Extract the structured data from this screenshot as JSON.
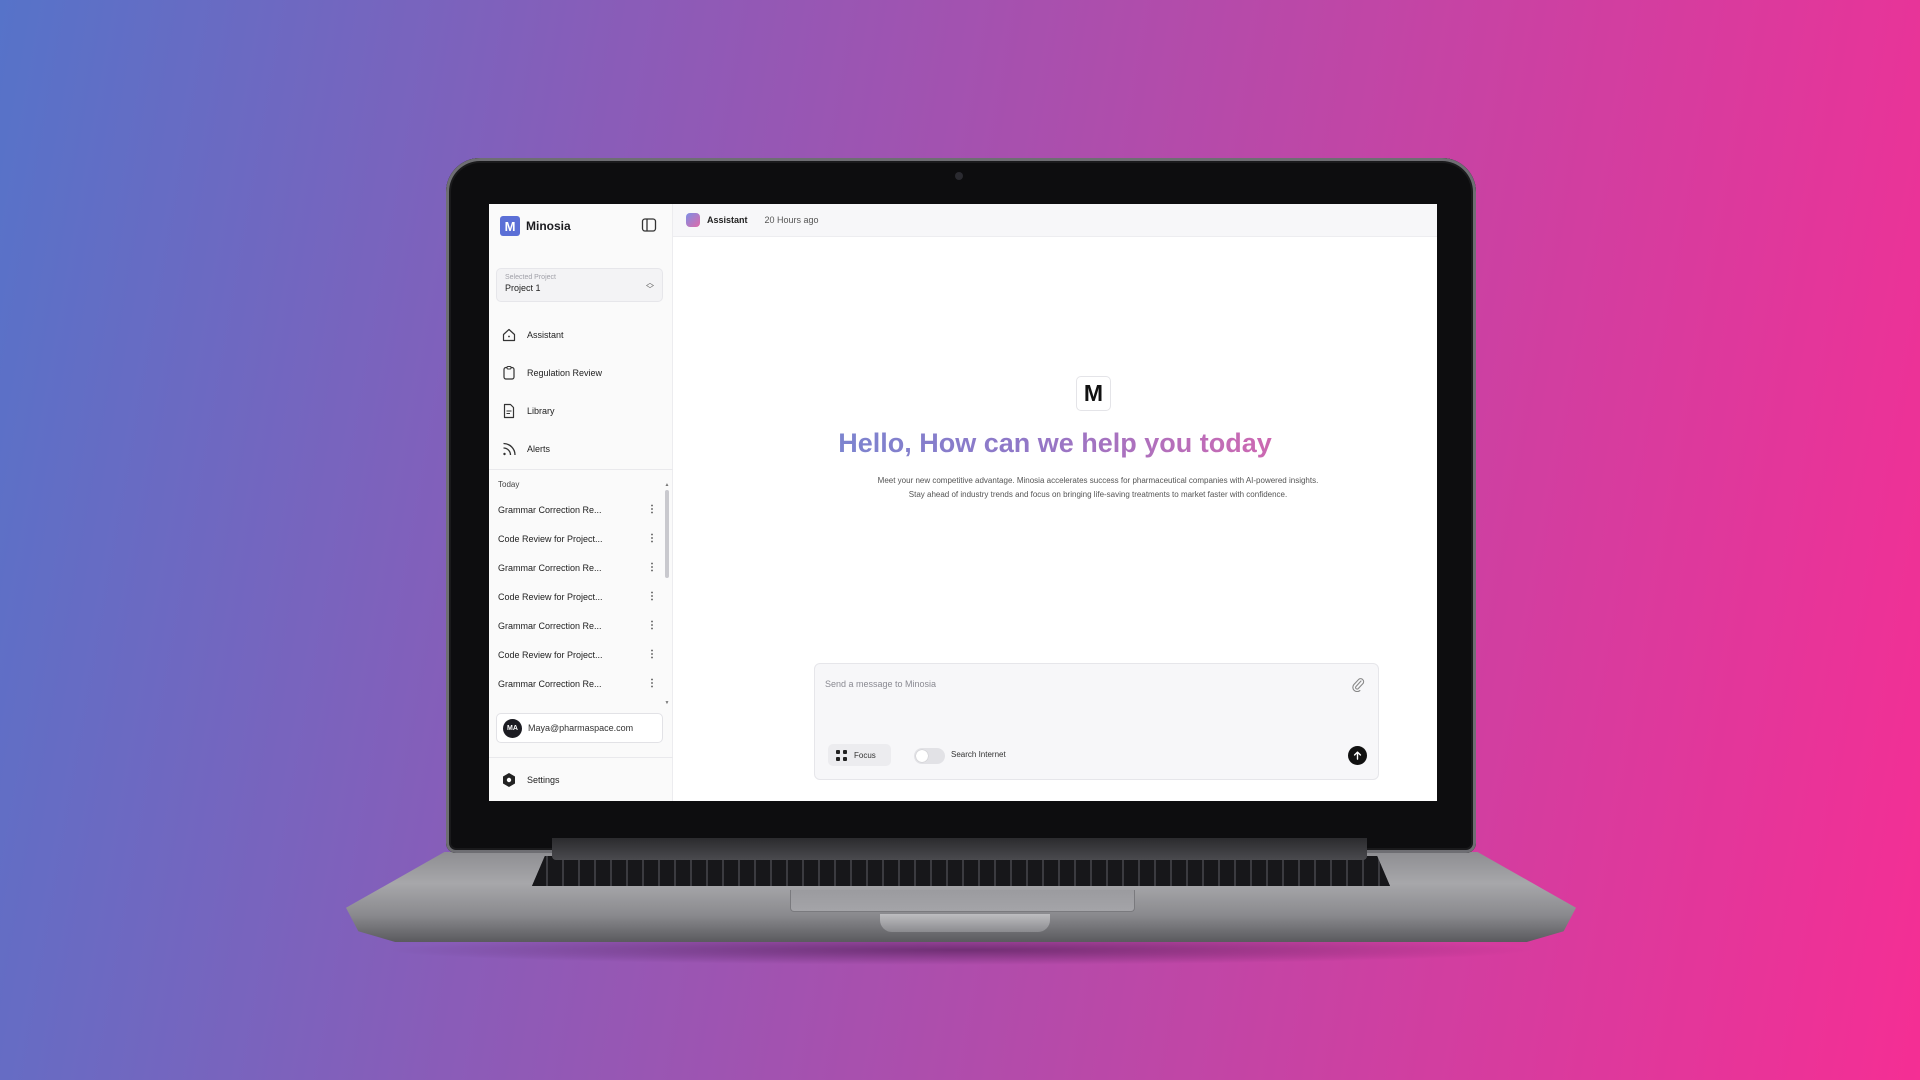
{
  "app": {
    "name": "Minosia",
    "logo_letter": "M"
  },
  "sidebar": {
    "project": {
      "caption": "Selected Project",
      "value": "Project 1"
    },
    "nav": [
      {
        "label": "Assistant",
        "icon": "home-icon"
      },
      {
        "label": "Regulation Review",
        "icon": "clipboard-icon"
      },
      {
        "label": "Library",
        "icon": "document-icon"
      },
      {
        "label": "Alerts",
        "icon": "rss-icon"
      }
    ],
    "history_heading": "Today",
    "history": [
      "Grammar Correction Re...",
      "Code Review for Project...",
      "Grammar Correction Re...",
      "Code Review for Project...",
      "Grammar Correction Re...",
      "Code Review for Project...",
      "Grammar Correction Re..."
    ],
    "user": {
      "initials": "MA",
      "email": "Maya@pharmaspace.com"
    },
    "settings_label": "Settings"
  },
  "topbar": {
    "title": "Assistant",
    "time": "20 Hours ago"
  },
  "hero": {
    "logo_letter": "M",
    "title": "Hello, How can we help you today",
    "subtitle_line1": "Meet your new competitive advantage. Minosia accelerates success for pharmaceutical companies with AI-powered insights.",
    "subtitle_line2": "Stay ahead of industry trends and focus on bringing life-saving treatments to market faster with confidence."
  },
  "composer": {
    "placeholder": "Send a message to Minosia",
    "focus_label": "Focus",
    "search_label": "Search Internet",
    "search_enabled": false
  },
  "colors": {
    "brand": "#5b6fd6",
    "hero_gradient_start": "#6b8fd6",
    "hero_gradient_end": "#e2589a"
  }
}
